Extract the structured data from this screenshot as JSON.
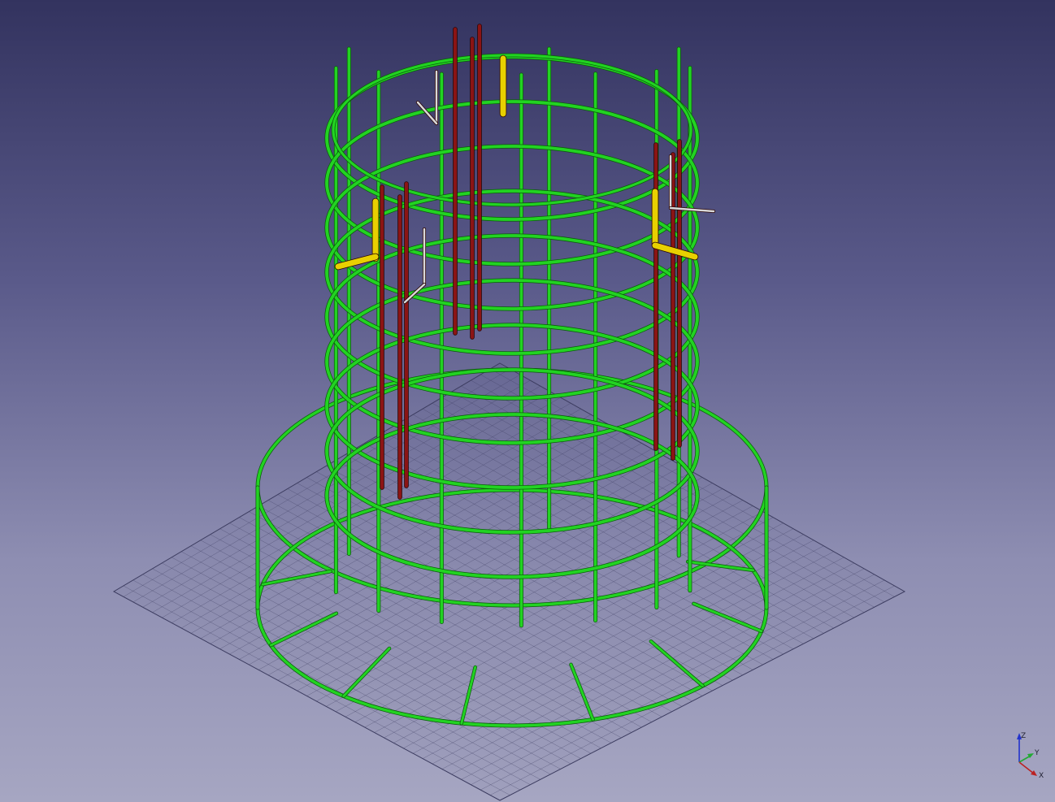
{
  "viewer": {
    "navigation_cube": {
      "x_label": "X",
      "y_label": "Y",
      "z_label": "Z"
    }
  },
  "colors": {
    "background_top": "#33335f",
    "background_bottom": "#a6a6c2",
    "stirrup_green": "#22d322",
    "rebar_red": "#8b1414",
    "rebar_yellow": "#e8d000",
    "rebar_white": "#d8d8d8",
    "grid_line": "#3c3c60"
  },
  "scene": {
    "shaft_rings": 9,
    "vertical_bars": 10,
    "base_rings": 2,
    "base_radial_bars": 12
  }
}
